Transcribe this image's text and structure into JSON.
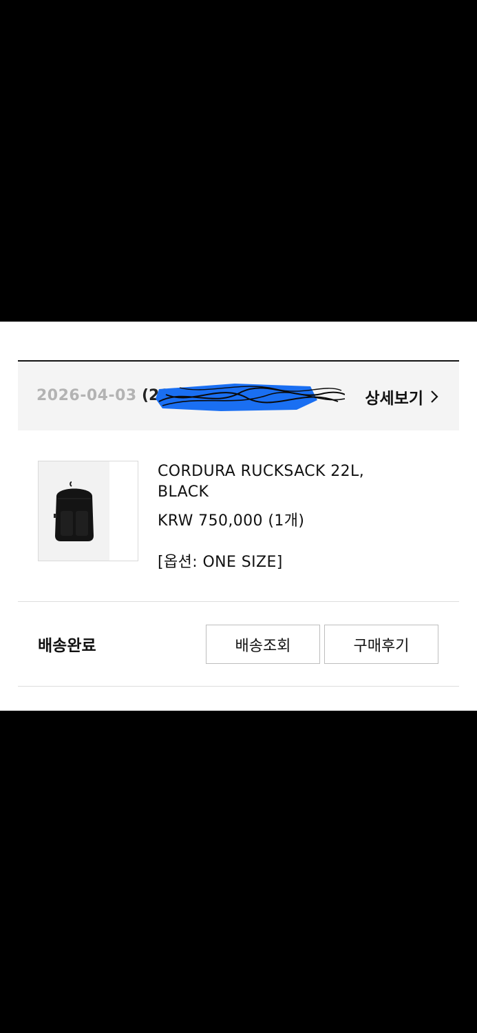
{
  "order": {
    "date": "2026-04-03",
    "number_visible": "(20",
    "detail_link_label": "상세보기",
    "chevron_icon": "chevron-right-icon"
  },
  "product": {
    "name": "CORDURA RUCKSACK 22L, BLACK",
    "price": "KRW 750,000 (1개)",
    "option": "[옵션: ONE SIZE]",
    "image_icon": "backpack-icon"
  },
  "status": {
    "label": "배송완료"
  },
  "actions": {
    "track_label": "배송조회",
    "review_label": "구매후기"
  },
  "colors": {
    "redaction_blue": "#1a6ff2",
    "date_gray": "#b3b3b3",
    "header_bg": "#f4f4f4"
  }
}
